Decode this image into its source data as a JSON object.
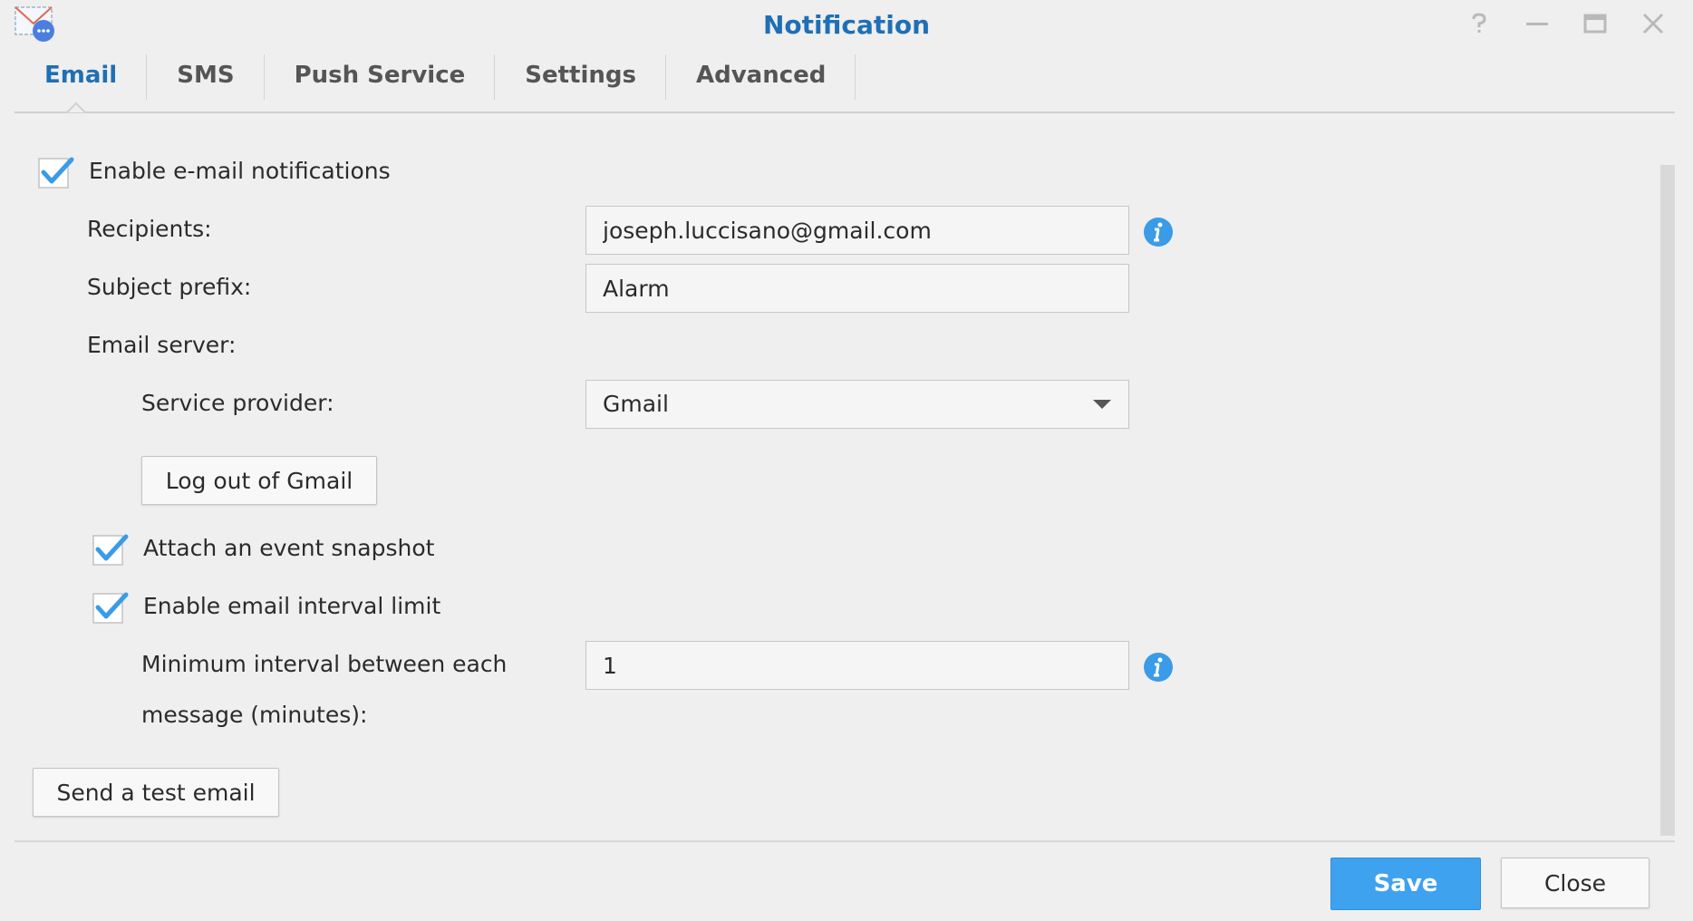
{
  "window": {
    "title": "Notification",
    "controls": [
      "help-icon",
      "minimize-icon",
      "maximize-icon",
      "close-icon"
    ]
  },
  "tabs": [
    {
      "label": "Email",
      "active": true
    },
    {
      "label": "SMS",
      "active": false
    },
    {
      "label": "Push Service",
      "active": false
    },
    {
      "label": "Settings",
      "active": false
    },
    {
      "label": "Advanced",
      "active": false
    }
  ],
  "email": {
    "enable_label": "Enable e-mail notifications",
    "enable_checked": true,
    "recipients_label": "Recipients:",
    "recipients_value": "joseph.luccisano@gmail.com",
    "subject_label": "Subject prefix:",
    "subject_value": "Alarm",
    "server_label": "Email server:",
    "provider_label": "Service provider:",
    "provider_value": "Gmail",
    "logout_button": "Log out of Gmail",
    "snapshot_label": "Attach an event snapshot",
    "snapshot_checked": true,
    "interval_limit_label": "Enable email interval limit",
    "interval_limit_checked": true,
    "interval_label_line1": "Minimum interval between each",
    "interval_label_line2": "message (minutes):",
    "interval_value": "1",
    "test_button": "Send a test email"
  },
  "footer": {
    "save_label": "Save",
    "close_label": "Close"
  },
  "colors": {
    "accent": "#1f6fb5",
    "primary_button": "#3fa2ee",
    "check": "#3a9be6",
    "info": "#3a9be6",
    "background": "#efefef"
  }
}
